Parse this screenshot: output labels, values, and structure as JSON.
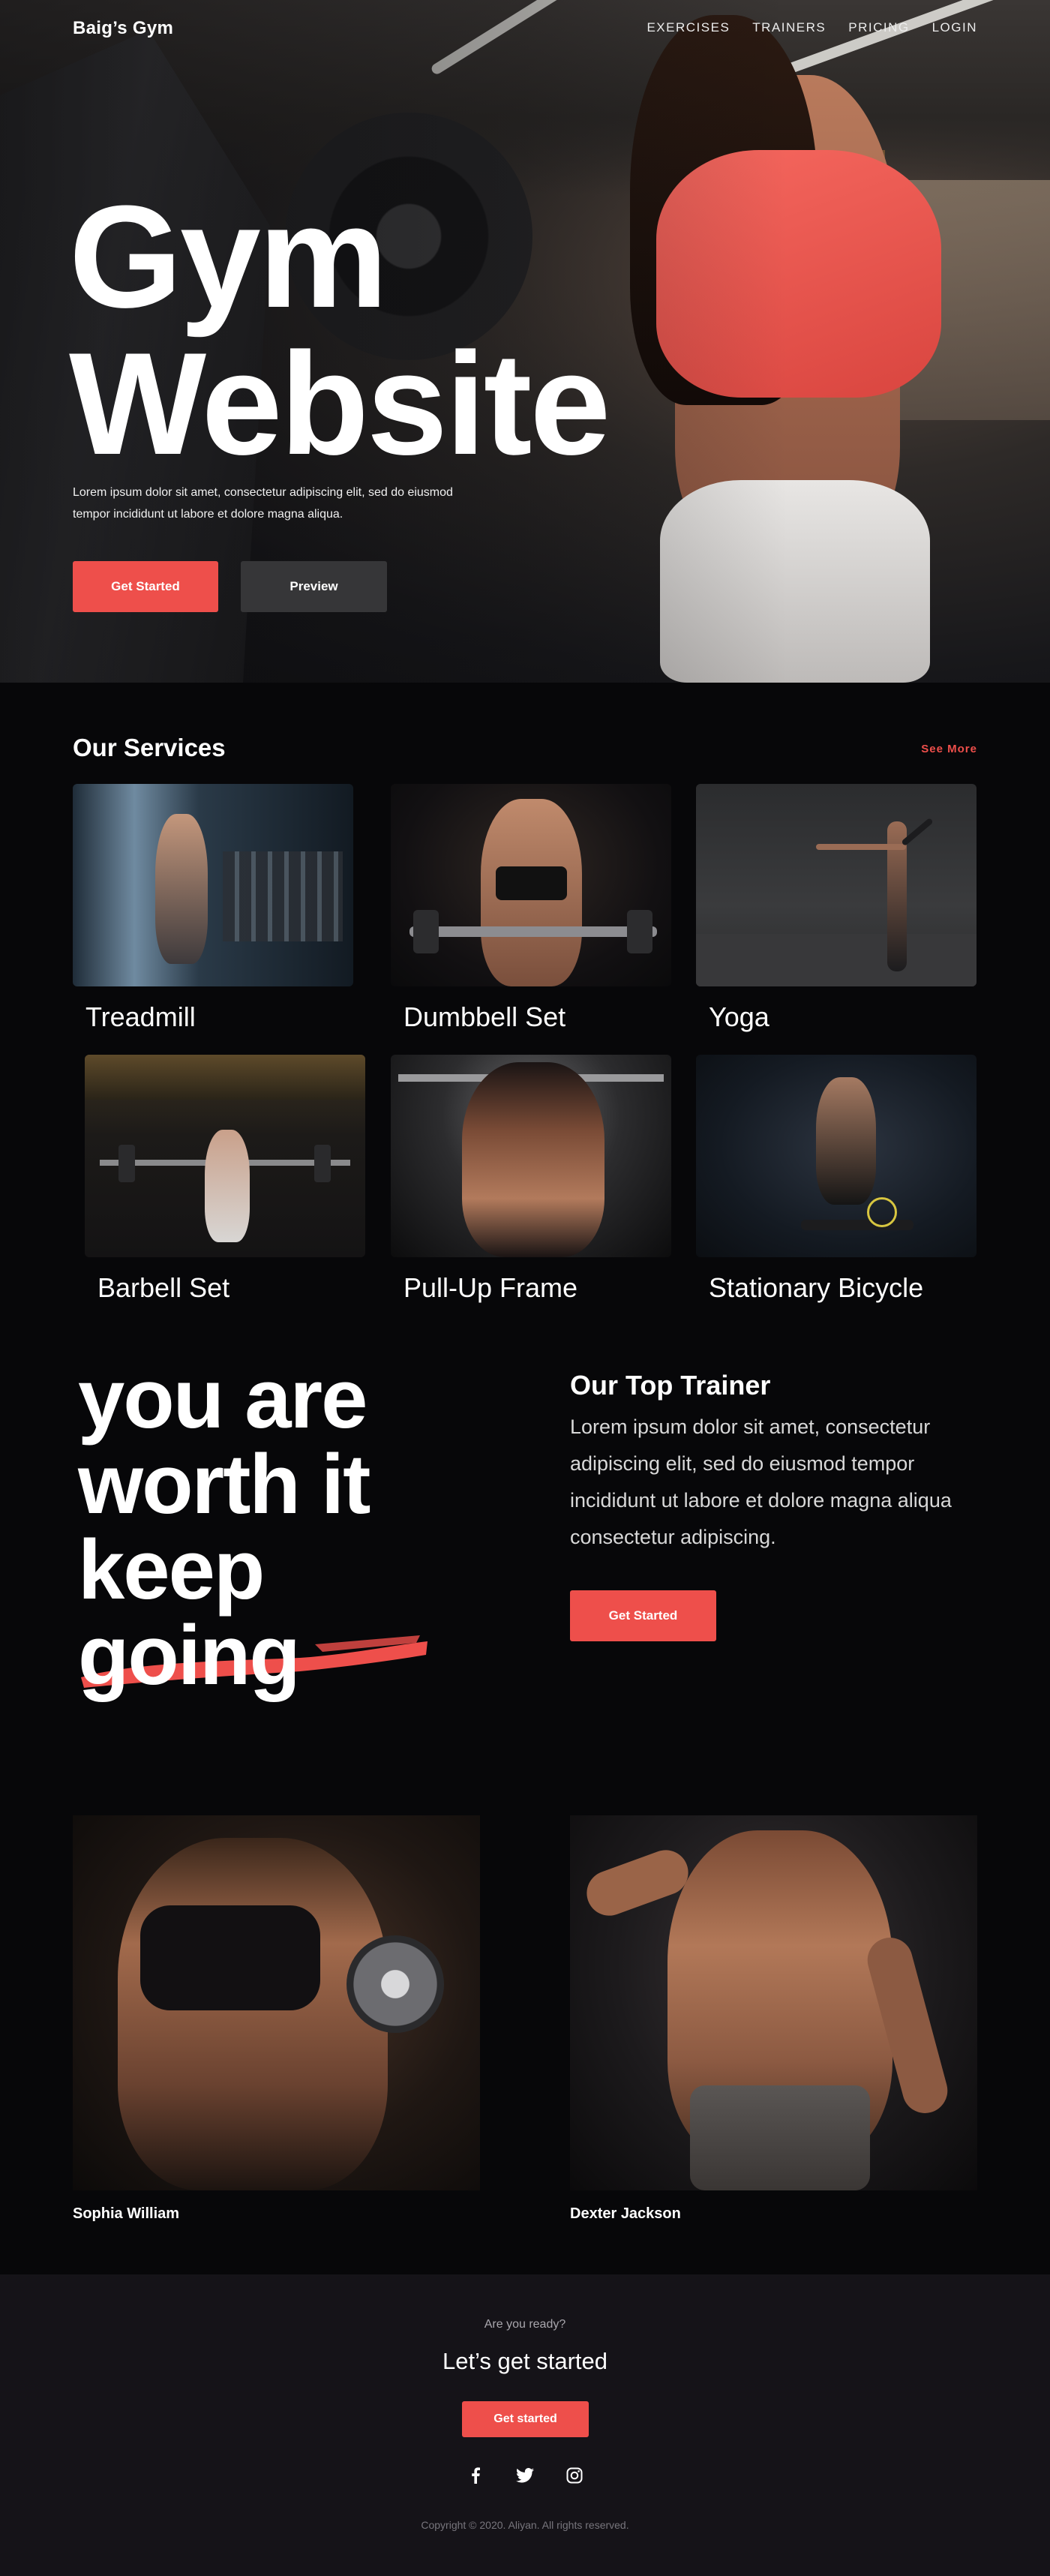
{
  "nav": {
    "brand": "Baig’s Gym",
    "links": [
      "EXERCISES",
      "TRAINERS",
      "PRICING",
      "LOGIN"
    ]
  },
  "hero": {
    "title_line1": "Gym",
    "title_line2": "Website",
    "description": "Lorem ipsum dolor sit amet, consectetur adipiscing elit, sed do eiusmod tempor incididunt ut labore et dolore magna aliqua.",
    "primary_button": "Get Started",
    "secondary_button": "Preview"
  },
  "services": {
    "title": "Our Services",
    "see_more": "See More",
    "items": [
      {
        "label": "Treadmill"
      },
      {
        "label": "Dumbbell Set"
      },
      {
        "label": "Yoga"
      },
      {
        "label": "Barbell Set"
      },
      {
        "label": "Pull-Up Frame"
      },
      {
        "label": "Stationary Bicycle"
      }
    ]
  },
  "motivation": {
    "line1": "you are",
    "line2": "worth it",
    "line3": "keep",
    "line4": "going"
  },
  "top_trainer": {
    "title": "Our Top Trainer",
    "description": "Lorem ipsum dolor sit amet, consectetur adipiscing elit, sed do eiusmod tempor incididunt ut labore et dolore magna aliqua consectetur adipiscing.",
    "button": "Get Started"
  },
  "trainers": [
    {
      "name": "Sophia William"
    },
    {
      "name": "Dexter Jackson"
    }
  ],
  "cta": {
    "eyebrow": "Are you ready?",
    "title": "Let’s get started",
    "button": "Get started"
  },
  "social_icons": [
    "facebook-icon",
    "twitter-icon",
    "instagram-icon"
  ],
  "footer": {
    "copyright": "Copyright © 2020. Aliyan. All rights reserved."
  },
  "colors": {
    "accent": "#ee4f4b",
    "background": "#070709",
    "footer_bg": "#151318",
    "secondary_button": "#363638"
  }
}
